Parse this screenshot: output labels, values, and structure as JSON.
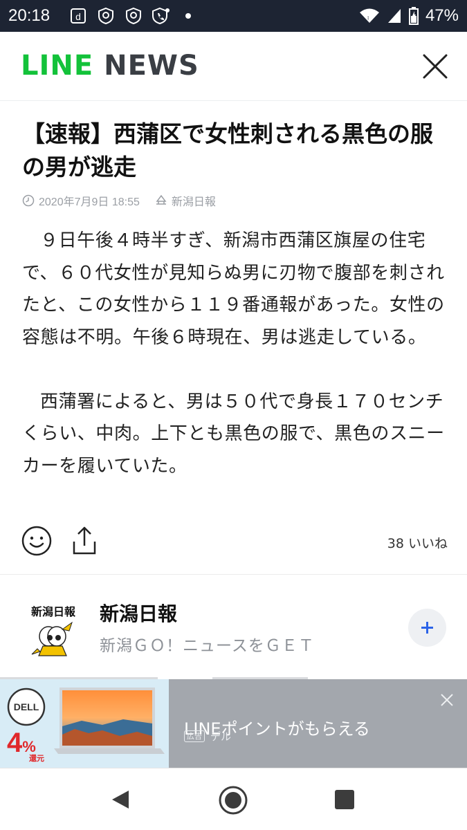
{
  "status_bar": {
    "time": "20:18",
    "battery_percent": "47%",
    "icons": [
      "d-app-icon",
      "shield-icon",
      "shield-icon",
      "phone-shield-icon",
      "dot-icon",
      "wifi-icon",
      "signal-icon",
      "battery-icon"
    ]
  },
  "header": {
    "logo_line": "LINE",
    "logo_news": "NEWS",
    "close_icon": "close-icon"
  },
  "article": {
    "title": "【速報】西蒲区で女性刺される黒色の服の男が逃走",
    "date": "2020年7月9日 18:55",
    "source": "新潟日報",
    "paragraphs": [
      "９日午後４時半すぎ、新潟市西蒲区旗屋の住宅で、６０代女性が見知らぬ男に刃物で腹部を刺されたと、この女性から１１９番通報があった。女性の容態は不明。午後６時現在、男は逃走している。",
      "西蒲署によると、男は５０代で身長１７０センチくらい、中肉。上下とも黒色の服で、黒色のスニーカーを履いていた。"
    ],
    "likes": "38 いいね"
  },
  "publisher": {
    "name": "新潟日報",
    "description": "新潟ＧＯ！ニュースをＧＥＴ",
    "logo_text": "新潟日報"
  },
  "ad": {
    "brand": "DELL",
    "percent": "4",
    "percent_sign": "%",
    "kangen": "還元",
    "headline": "LINEポイントがもらえる",
    "badge": "広告",
    "advertiser": "デル"
  },
  "colors": {
    "line_green": "#13c23a",
    "status_bar": "#1d2433",
    "follow_blue": "#2b63e8",
    "ad_red": "#e0282b"
  }
}
